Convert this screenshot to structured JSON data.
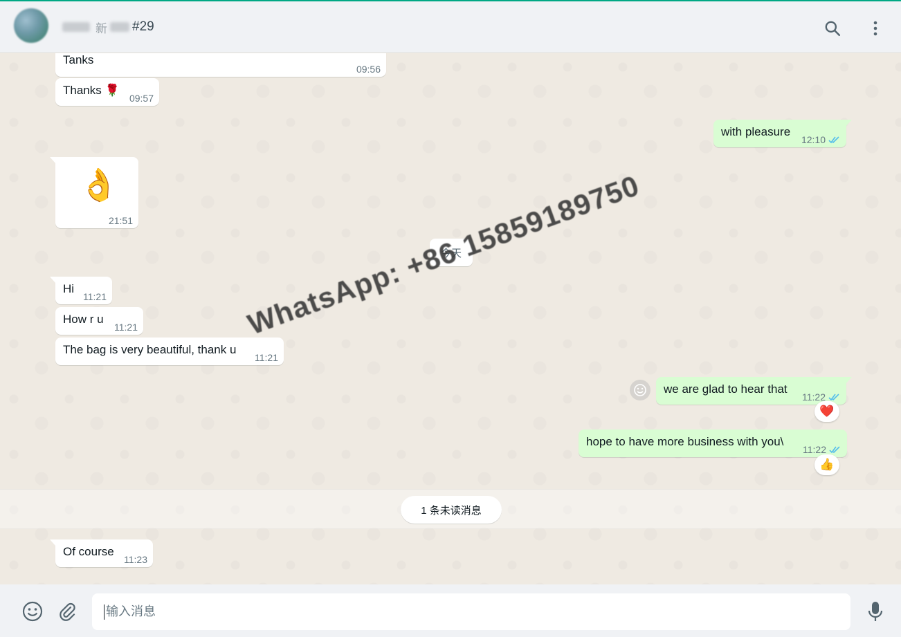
{
  "header": {
    "contact_name_char": "新",
    "contact_suffix": "#29"
  },
  "messages": {
    "m1": {
      "text": "Tanks",
      "time": "09:56"
    },
    "m2": {
      "text": "Thanks 🌹",
      "time": "09:57"
    },
    "m3": {
      "text": "with pleasure",
      "time": "12:10"
    },
    "m4": {
      "text": "👌",
      "time": "21:51"
    },
    "m5": {
      "text": "Hi",
      "time": "11:21"
    },
    "m6": {
      "text": "How r u",
      "time": "11:21"
    },
    "m7": {
      "text": "The bag is very beautiful,  thank u",
      "time": "11:21"
    },
    "m8": {
      "text": "we are glad to hear that",
      "time": "11:22",
      "reaction": "❤️"
    },
    "m9": {
      "text": "hope to have more business with you\\",
      "time": "11:22",
      "reaction": "👍"
    },
    "m10": {
      "text": "Of course",
      "time": "11:23"
    }
  },
  "date_divider": "今天",
  "unread_divider": "1 条未读消息",
  "watermark": "WhatsApp: +86 15859189750",
  "composer": {
    "placeholder": "输入消息"
  },
  "icons": {
    "header": [
      "search-icon",
      "menu-icon"
    ],
    "footer": [
      "emoji-icon",
      "attach-icon",
      "mic-icon"
    ],
    "read_receipt": "double-check-icon"
  },
  "colors": {
    "accent": "#00a884",
    "outgoing_bubble": "#d9fdd3",
    "incoming_bubble": "#ffffff",
    "read_tick": "#53bdeb",
    "chat_background": "#efeae2"
  }
}
